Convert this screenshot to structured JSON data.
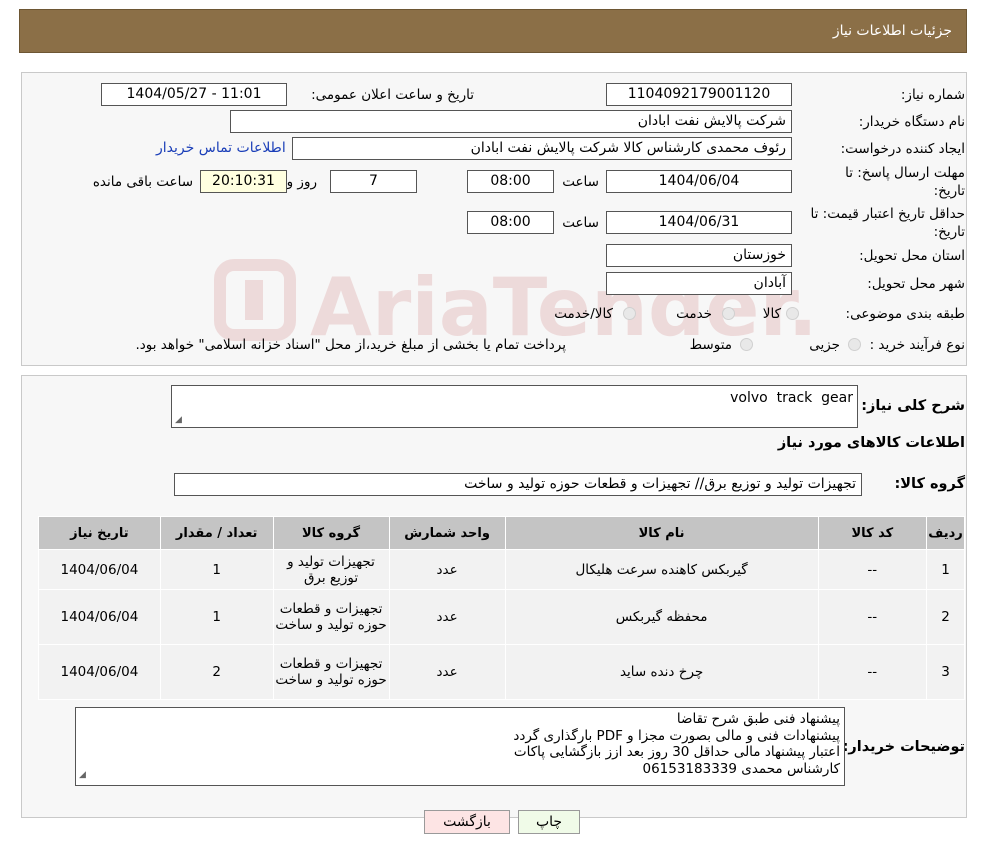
{
  "header": {
    "title": "جزئیات اطلاعات نیاز"
  },
  "form": {
    "need_number_label": "شماره نیاز:",
    "need_number": "1104092179001120",
    "announce_label": "تاریخ و ساعت اعلان عمومی:",
    "announce_value": "1404/05/27 - 11:01",
    "buyer_org_label": "نام دستگاه خریدار:",
    "buyer_org": "شرکت پالایش نفت ابادان",
    "creator_label": "ایجاد کننده درخواست:",
    "creator": "رئوف محمدی کارشناس کالا شرکت پالایش نفت ابادان",
    "contact_link": "اطلاعات تماس خریدار",
    "deadline_label_1": "مهلت ارسال پاسخ: تا",
    "deadline_label_2": "تاریخ:",
    "deadline_date": "1404/06/04",
    "time_label": "ساعت",
    "deadline_time": "08:00",
    "days_value": "7",
    "days_label": "روز و",
    "remaining_time": "20:10:31",
    "remaining_label": "ساعت باقی مانده",
    "validity_label_1": "حداقل تاریخ اعتبار قیمت: تا",
    "validity_label_2": "تاریخ:",
    "validity_date": "1404/06/31",
    "validity_time": "08:00",
    "province_label": "استان محل تحویل:",
    "province": "خوزستان",
    "city_label": "شهر محل تحویل:",
    "city": "آبادان",
    "category_label": "طبقه بندی موضوعی:",
    "category_options": [
      "کالا",
      "خدمت",
      "کالا/خدمت"
    ],
    "process_label": "نوع فرآیند خرید :",
    "process_options": [
      "جزیی",
      "متوسط"
    ],
    "process_note": "پرداخت تمام یا بخشی از مبلغ خرید،از محل \"اسناد خزانه اسلامی\" خواهد بود."
  },
  "summary": {
    "desc_label": "شرح کلی نیاز:",
    "desc_value": "volvo  track  gear",
    "goods_title": "اطلاعات کالاهای مورد نیاز",
    "group_label": "گروه کالا:",
    "group_value": "تجهیزات تولید و توزیع برق// تجهیزات و قطعات حوزه تولید و ساخت"
  },
  "table": {
    "headers": [
      "ردیف",
      "کد کالا",
      "نام کالا",
      "واحد شمارش",
      "گروه کالا",
      "تعداد / مقدار",
      "تاریخ نیاز"
    ],
    "rows": [
      [
        "1",
        "--",
        "گیربکس کاهنده سرعت هلیکال",
        "عدد",
        "تجهیزات تولید و توزیع برق",
        "1",
        "1404/06/04"
      ],
      [
        "2",
        "--",
        "محفظه گیربکس",
        "عدد",
        "تجهیزات و قطعات حوزه تولید و ساخت",
        "1",
        "1404/06/04"
      ],
      [
        "3",
        "--",
        "چرخ دنده ساید",
        "عدد",
        "تجهیزات و قطعات حوزه تولید و ساخت",
        "2",
        "1404/06/04"
      ]
    ]
  },
  "notes": {
    "label": "توضیحات خریدار:",
    "lines": [
      "پیشنهاد فنی طبق شرح تقاضا",
      "پیشنهادات فنی و مالی بصورت مجزا و PDF  بارگذاری گردد",
      "اعتبار پیشنهاد مالی حداقل 30 روز بعد ازز بازگشایی پاکات",
      "کارشناس محمدی 06153183339"
    ]
  },
  "buttons": {
    "print": "چاپ",
    "back": "بازگشت"
  },
  "watermark": {
    "text": "AriaTender.neT",
    "color": "#b22222"
  }
}
